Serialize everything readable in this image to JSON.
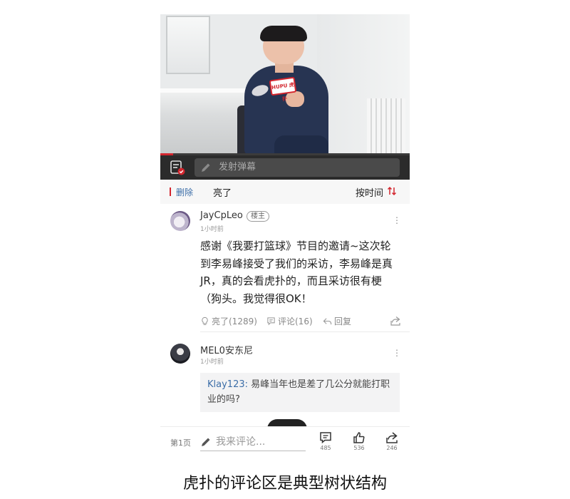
{
  "video": {
    "mic_label": "HUPU 虎扑",
    "progress": 0.05,
    "danmaku_placeholder": "发射弹幕"
  },
  "section": {
    "delete_label": "删除",
    "title": "亮了",
    "sort_label": "按时间"
  },
  "comments": [
    {
      "username": "JayCpLeo",
      "badge": "楼主",
      "time": "1小时前",
      "body": "感谢《我要打篮球》节目的邀请~这次轮到李易峰接受了我们的采访，李易峰是真JR，真的会看虎扑的，而且采访很有梗（狗头。我觉得很OK！",
      "like_label": "亮了(1289)",
      "reply_label": "评论(16)",
      "quote_label": "回复"
    },
    {
      "username": "MEL0安东尼",
      "time": "1小时前",
      "quote_user": "Klay123:",
      "quote_text": " 易峰当年也是差了几公分就能打职业的吗?"
    }
  ],
  "bottom_bar": {
    "page": "第1页",
    "input_placeholder": "我来评论...",
    "comments_count": "485",
    "likes_count": "536",
    "shares_count": "246"
  },
  "caption": "虎扑的评论区是典型树状结构",
  "colors": {
    "accent_red": "#d3262e",
    "link_blue": "#3c6ea8"
  }
}
